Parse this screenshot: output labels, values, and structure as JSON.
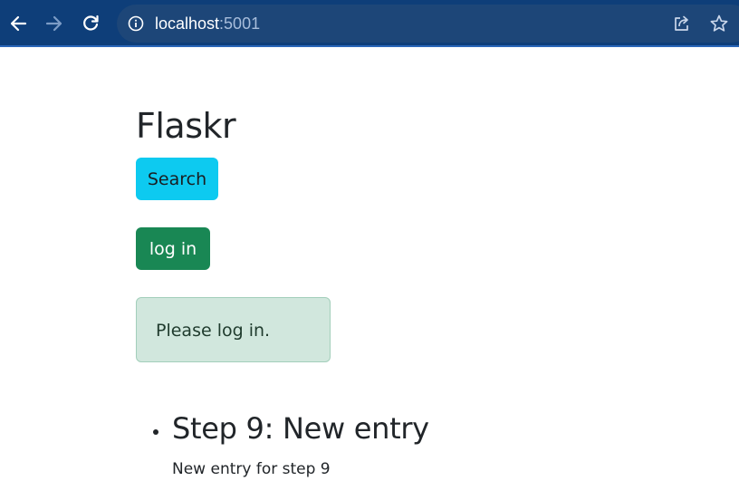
{
  "browser": {
    "url_host": "localhost",
    "url_port": ":5001"
  },
  "page": {
    "title": "Flaskr",
    "search_label": "Search",
    "login_label": "log in",
    "flash_message": "Please log in."
  },
  "entries": [
    {
      "title": "Step 9: New entry",
      "text": "New entry for step 9"
    }
  ],
  "colors": {
    "chrome_bg": "#0e3e79",
    "omnibox_bg": "#1d4678",
    "search_btn": "#0dcaf0",
    "login_btn": "#198754",
    "alert_bg": "#d1e7dd"
  }
}
